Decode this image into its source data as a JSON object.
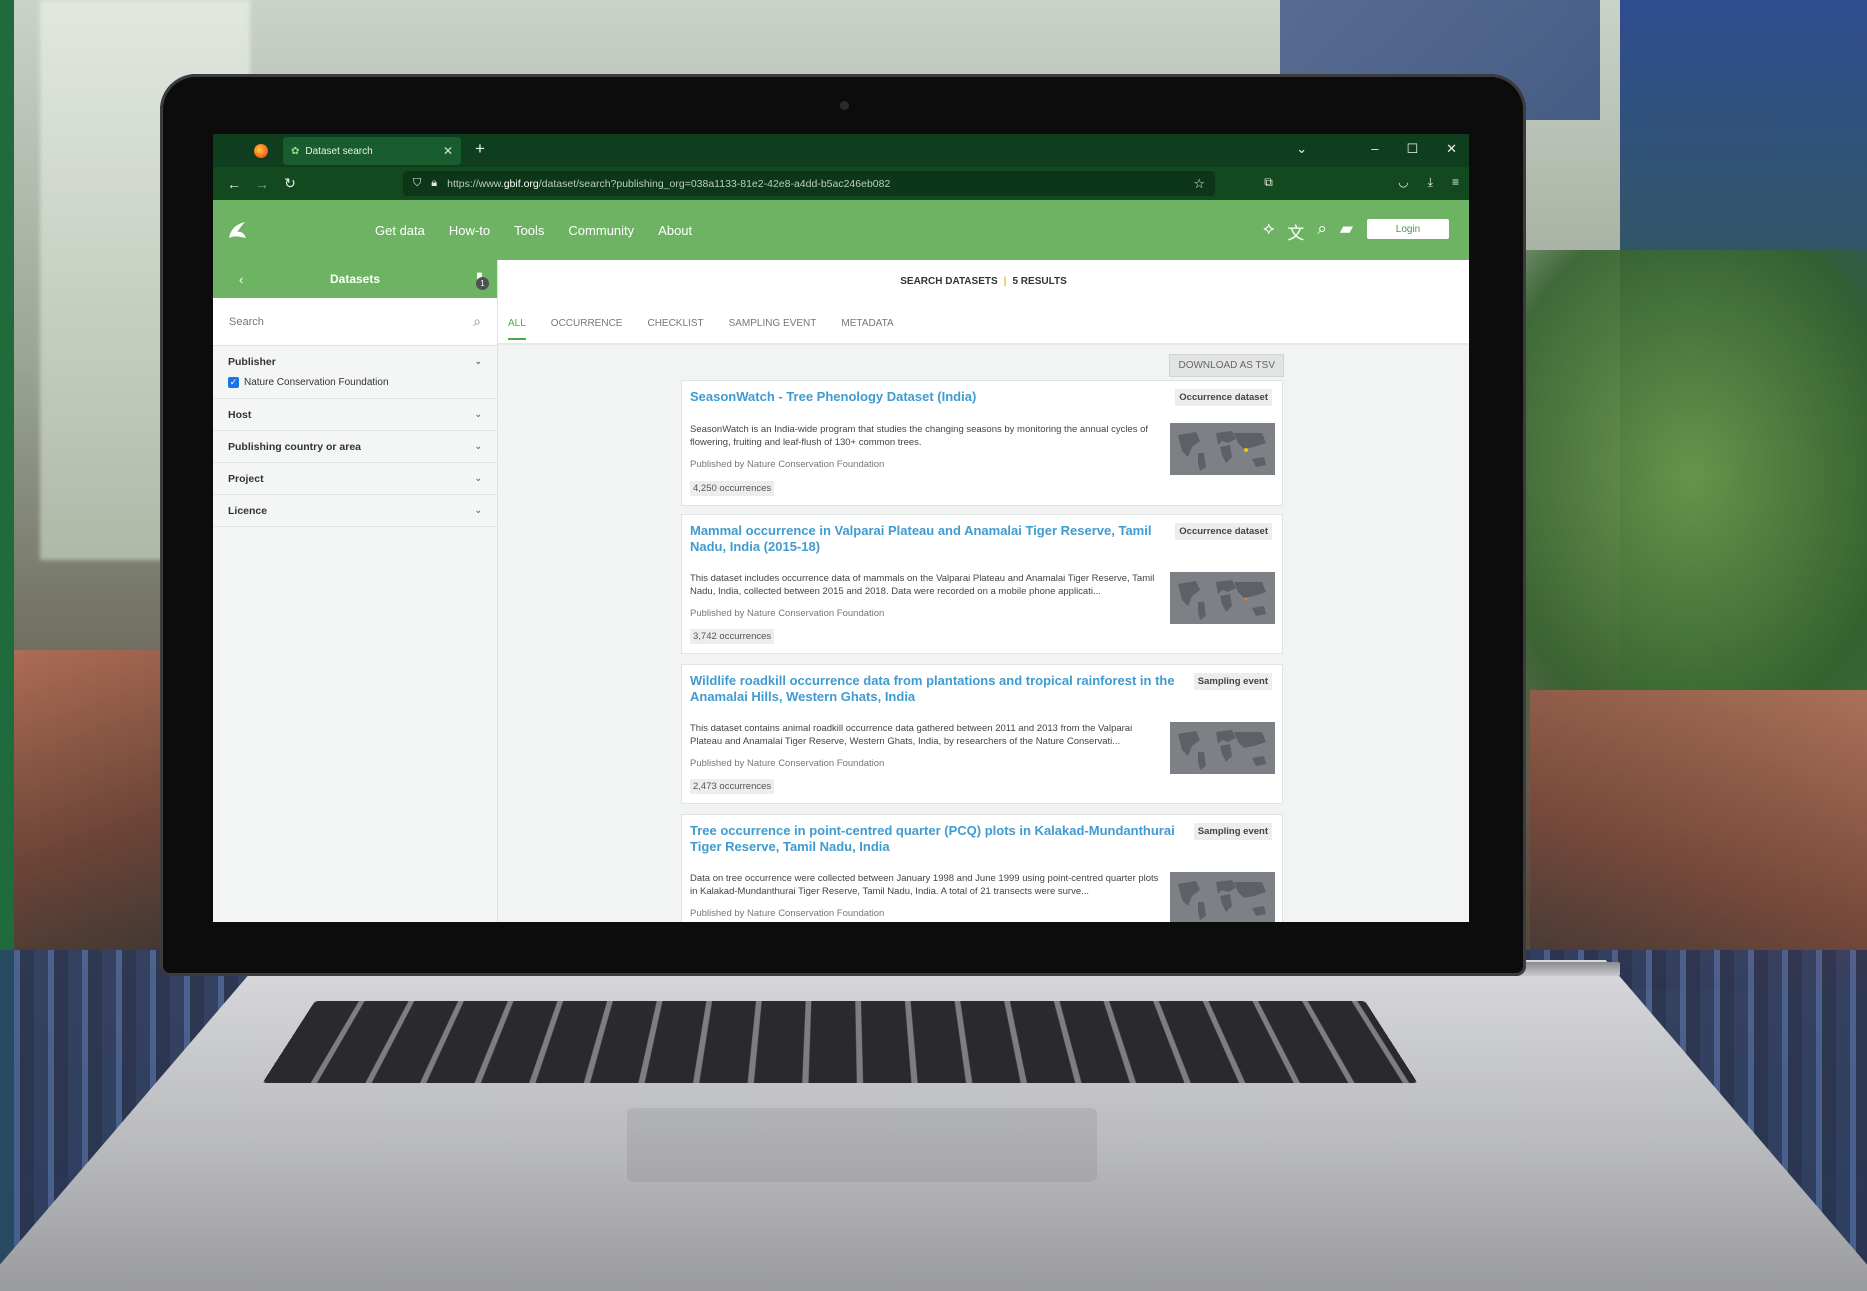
{
  "browser": {
    "tab_title": "Dataset search",
    "url_prefix": "https://www.",
    "url_host": "gbif.org",
    "url_path": "/dataset/search?publishing_org=038a1133-81e2-42e8-a4dd-b5ac246eb082",
    "new_tab": "+",
    "close": "✕"
  },
  "site": {
    "nav": [
      "Get data",
      "How-to",
      "Tools",
      "Community",
      "About"
    ],
    "login": "Login"
  },
  "sidebar": {
    "title": "Datasets",
    "filter_count": "1",
    "search_placeholder": "Search",
    "facets": [
      {
        "label": "Publisher",
        "options": [
          {
            "label": "Nature Conservation Foundation",
            "checked": true
          }
        ]
      },
      {
        "label": "Host"
      },
      {
        "label": "Publishing country or area"
      },
      {
        "label": "Project"
      },
      {
        "label": "Licence"
      }
    ]
  },
  "results": {
    "heading": "SEARCH DATASETS",
    "count": "5 RESULTS",
    "tabs": [
      "ALL",
      "OCCURRENCE",
      "CHECKLIST",
      "SAMPLING EVENT",
      "METADATA"
    ],
    "active_tab": "ALL",
    "download": "DOWNLOAD AS TSV",
    "items": [
      {
        "title": "SeasonWatch - Tree Phenology Dataset (India)",
        "type": "Occurrence dataset",
        "description": "SeasonWatch is an India-wide program that studies the changing seasons by monitoring the annual cycles of flowering, fruiting and leaf-flush of 130+ common trees.",
        "publisher": "Published by Nature Conservation Foundation",
        "occurrences": "4,250 occurrences"
      },
      {
        "title": "Mammal occurrence in Valparai Plateau and Anamalai Tiger Reserve, Tamil Nadu, India (2015-18)",
        "type": "Occurrence dataset",
        "description": "This dataset includes occurrence data of mammals on the Valparai Plateau and Anamalai Tiger Reserve, Tamil Nadu, India, collected between 2015 and 2018. Data were recorded on a mobile phone applicati...",
        "publisher": "Published by Nature Conservation Foundation",
        "occurrences": "3,742 occurrences"
      },
      {
        "title": "Wildlife roadkill occurrence data from plantations and tropical rainforest in the Anamalai Hills, Western Ghats, India",
        "type": "Sampling event",
        "description": "This dataset contains animal roadkill occurrence data gathered between 2011 and 2013 from the Valparai Plateau and Anamalai Tiger Reserve, Western Ghats, India, by researchers of the Nature Conservati...",
        "publisher": "Published by Nature Conservation Foundation",
        "occurrences": "2,473 occurrences"
      },
      {
        "title": "Tree occurrence in point-centred quarter (PCQ) plots in Kalakad-Mundanthurai Tiger Reserve, Tamil Nadu, India",
        "type": "Sampling event",
        "description": "Data on tree occurrence were collected between January 1998 and June 1999 using point-centred quarter plots in Kalakad-Mundanthurai Tiger Reserve, Tamil Nadu, India. A total of 21 transects were surve...",
        "publisher": "Published by Nature Conservation Foundation",
        "occurrences": ""
      }
    ]
  }
}
